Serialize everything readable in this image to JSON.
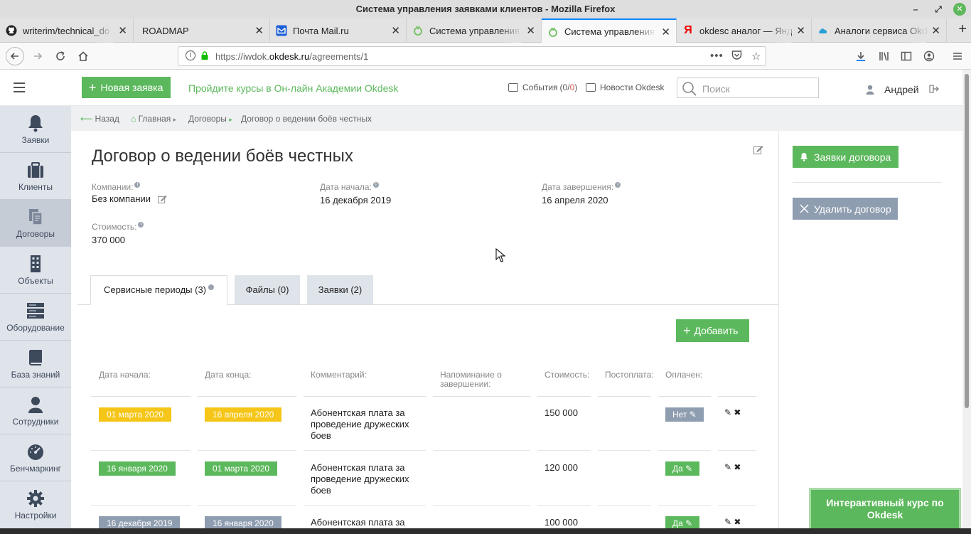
{
  "window": {
    "title": "Система управления заявками клиентов - Mozilla Firefox",
    "min": "–",
    "max": "⤢",
    "close": "✕"
  },
  "browser_tabs": [
    {
      "label": "writerim/technical_do",
      "icon": "github-icon"
    },
    {
      "label": "ROADMAP",
      "icon": "none"
    },
    {
      "label": "Почта Mail.ru",
      "icon": "mail-icon"
    },
    {
      "label": "Система управления",
      "icon": "okdesk-icon"
    },
    {
      "label": "Система управления",
      "icon": "okdesk-icon",
      "active": true
    },
    {
      "label": "okdesc аналог — Янд",
      "icon": "yandex-icon"
    },
    {
      "label": "Аналоги сервиса Okd",
      "icon": "cloud-icon"
    }
  ],
  "url": {
    "prefix": "https://iwdok.",
    "domain": "okdesk.ru",
    "path": "/agreements/1",
    "more": "•••"
  },
  "header": {
    "new_request": "Новая заявка",
    "academy": "Пройдите курсы в Он-лайн Академии Okdesk",
    "events_label": "События",
    "events_open": "(0/",
    "events_red": "0",
    "events_close": ")",
    "news": "Новости Okdesk",
    "search_placeholder": "Поиск",
    "user": "Андрей"
  },
  "sidebar": {
    "items": [
      {
        "label": "Заявки",
        "icon": "bell-icon"
      },
      {
        "label": "Клиенты",
        "icon": "briefcase-icon"
      },
      {
        "label": "Договоры",
        "icon": "documents-icon",
        "active": true
      },
      {
        "label": "Объекты",
        "icon": "building-icon"
      },
      {
        "label": "Оборудование",
        "icon": "server-icon"
      },
      {
        "label": "База знаний",
        "icon": "book-icon"
      },
      {
        "label": "Сотрудники",
        "icon": "person-icon"
      },
      {
        "label": "Бенчмаркинг",
        "icon": "gauge-icon"
      },
      {
        "label": "Настройки",
        "icon": "gear-icon"
      }
    ]
  },
  "breadcrumb": {
    "back": "Назад",
    "home": "Главная",
    "contracts": "Договоры",
    "current": "Договор о ведении боёв честных",
    "sep": "▸"
  },
  "contract": {
    "title": "Договор о ведении боёв честных",
    "company_label": "Компании:",
    "company_value": "Без компании",
    "start_label": "Дата начала:",
    "start_value": "16 декабря 2019",
    "end_label": "Дата завершения:",
    "end_value": "16 апреля 2020",
    "cost_label": "Стоимость:",
    "cost_value": "370 000"
  },
  "actions": {
    "requests": "Заявки договора",
    "delete": "Удалить договор"
  },
  "tabs": {
    "periods": "Сервисные периоды (3)",
    "files": "Файлы (0)",
    "requests": "Заявки (2)"
  },
  "add_button": "Добавить",
  "table": {
    "headers": {
      "start": "Дата начала:",
      "end": "Дата конца:",
      "comment": "Комментарий:",
      "reminder_1": "Напоминание о",
      "reminder_2": "завершении:",
      "cost": "Стоимость:",
      "postpay": "Постоплата:",
      "paid": "Оплачен:"
    },
    "rows": [
      {
        "start": "01 марта 2020",
        "end": "16 апреля 2020",
        "comment_1": "Абонентская плата за",
        "comment_2": "проведение дружеских",
        "comment_3": "боев",
        "cost": "150 000",
        "paid": "Нет",
        "date_color": "#f5c517"
      },
      {
        "start": "16 января 2020",
        "end": "01 марта 2020",
        "comment_1": "Абонентская плата за",
        "comment_2": "проведение дружеских",
        "comment_3": "боев",
        "cost": "120 000",
        "paid": "Да",
        "date_color": "#5cb85c"
      },
      {
        "start": "16 декабря 2019",
        "end": "16 января 2020",
        "comment_1": "Абонентская плата за",
        "comment_2": "",
        "comment_3": "",
        "cost": "100 000",
        "paid": "Да",
        "date_color": "#8f9db0"
      }
    ]
  },
  "course_widget": {
    "line1": "Интерактивный курс по",
    "line2": "Okdesk"
  },
  "colors": {
    "accent": "#5cb85c",
    "sidebar": "#dfe3ea",
    "warning": "#f5c517",
    "muted": "#8f9db0",
    "firefox_blue": "#0a84ff"
  }
}
